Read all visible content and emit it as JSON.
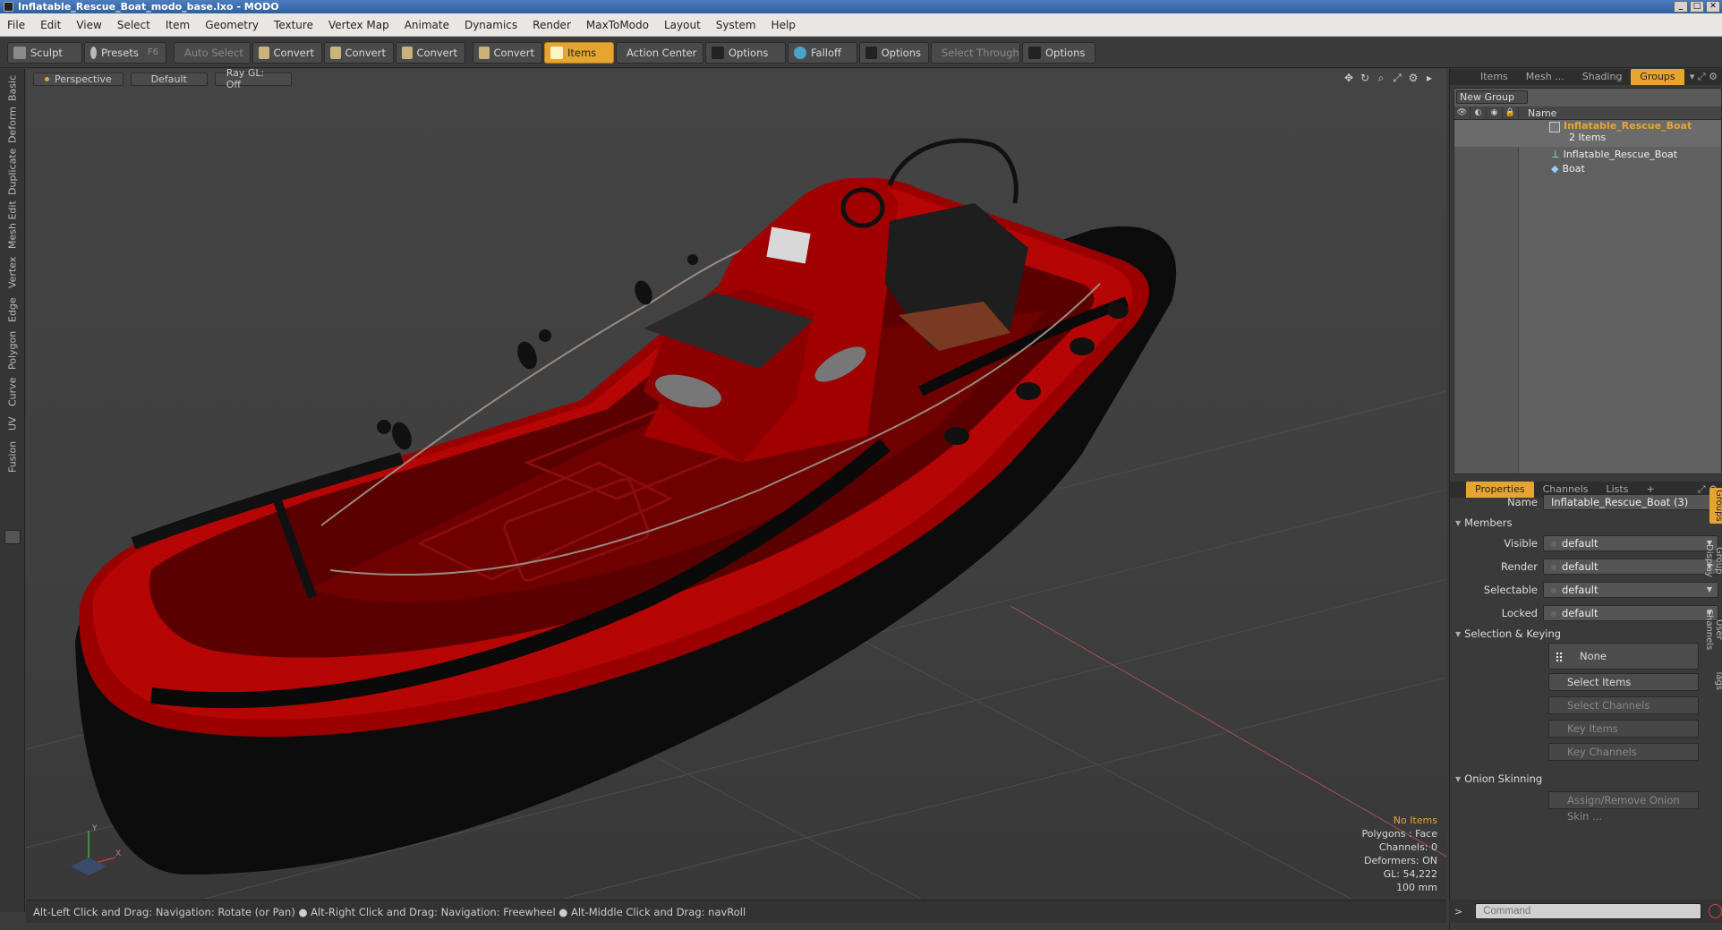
{
  "window": {
    "title": "Inflatable_Rescue_Boat_modo_base.lxo - MODO"
  },
  "menu": [
    "File",
    "Edit",
    "View",
    "Select",
    "Item",
    "Geometry",
    "Texture",
    "Vertex Map",
    "Animate",
    "Dynamics",
    "Render",
    "MaxToModo",
    "Layout",
    "System",
    "Help"
  ],
  "toolbar": {
    "sculpt": "Sculpt",
    "presets": "Presets",
    "presets_key": "F6",
    "auto_select": "Auto Select",
    "convert1": "Convert",
    "convert2": "Convert",
    "convert3": "Convert",
    "convert4": "Convert",
    "items": "Items",
    "action_center": "Action Center",
    "options1": "Options",
    "falloff": "Falloff",
    "options2": "Options",
    "select_through": "Select Through",
    "options3": "Options"
  },
  "left_tabs": [
    "Basic",
    "Deform",
    "Duplicate",
    "Mesh Edit",
    "Vertex",
    "Edge",
    "Polygon",
    "Curve",
    "UV",
    "Fusion"
  ],
  "viewport": {
    "view": "Perspective",
    "style": "Default",
    "raygl": "Ray GL: Off",
    "info": {
      "selection": "No Items",
      "polygons": "Polygons : Face",
      "channels": "Channels: 0",
      "deformers": "Deformers: ON",
      "gl": "GL: 54,222",
      "scale": "100 mm"
    },
    "axis": {
      "x": "X",
      "y": "Y"
    }
  },
  "status": "Alt-Left Click and Drag: Navigation: Rotate (or Pan) ● Alt-Right Click and Drag: Navigation: Freewheel ● Alt-Middle Click and Drag: navRoll",
  "top_tabs": [
    "Items",
    "Mesh ...",
    "Shading",
    "Groups"
  ],
  "groups": {
    "new_group": "New Group",
    "col_name": "Name",
    "root": "Inflatable_Rescue_Boat",
    "root_count": "2 Items",
    "children": [
      "Inflatable_Rescue_Boat",
      "Boat"
    ]
  },
  "props_tabs": [
    "Properties",
    "Channels",
    "Lists",
    "+"
  ],
  "properties": {
    "name_label": "Name",
    "name_value": "Inflatable_Rescue_Boat (3)",
    "members": "Members",
    "visible_label": "Visible",
    "visible_value": "default",
    "render_label": "Render",
    "render_value": "default",
    "selectable_label": "Selectable",
    "selectable_value": "default",
    "locked_label": "Locked",
    "locked_value": "default",
    "sel_keying": "Selection & Keying",
    "none": "None",
    "select_items": "Select Items",
    "select_channels": "Select Channels",
    "key_items": "Key Items",
    "key_channels": "Key Channels",
    "onion": "Onion Skinning",
    "assign_onion": "Assign/Remove Onion Skin ..."
  },
  "side_tabs": [
    "Groups",
    "Group Display",
    "User Channels",
    "Tags"
  ],
  "command": {
    "prompt": ">",
    "placeholder": "Command"
  },
  "colors": {
    "accent": "#e6a531",
    "boat": "#b00000"
  }
}
